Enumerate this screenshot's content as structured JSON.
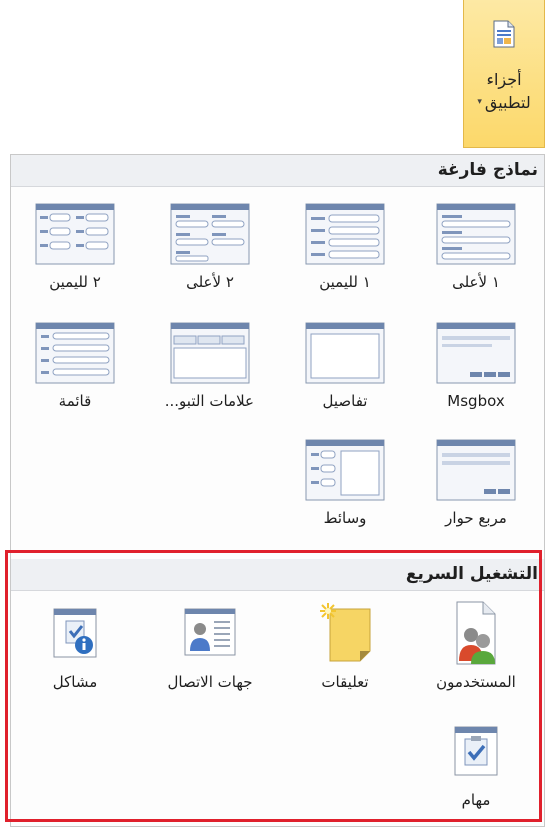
{
  "ribbon": {
    "button_line1": "أجزاء",
    "button_line2": "لتطبيق",
    "dropdown_caret": "▾"
  },
  "blank_forms": {
    "title": "نماذج فارغة",
    "items": [
      {
        "label": "١ لأعلى",
        "icon": "layout-top-1-icon"
      },
      {
        "label": "١ لليمين",
        "icon": "layout-right-1-icon"
      },
      {
        "label": "٢ لأعلى",
        "icon": "layout-top-2-icon"
      },
      {
        "label": "٢ لليمين",
        "icon": "layout-right-2-icon"
      },
      {
        "label": "Msgbox",
        "icon": "msgbox-icon"
      },
      {
        "label": "تفاصيل",
        "icon": "details-icon"
      },
      {
        "label": "علامات التبو...",
        "icon": "tabs-icon"
      },
      {
        "label": "قائمة",
        "icon": "list-icon"
      },
      {
        "label": "مربع حوار",
        "icon": "dialog-icon"
      },
      {
        "label": "وسائط",
        "icon": "media-icon"
      }
    ]
  },
  "quick_start": {
    "title": "التشغيل السريع",
    "items": [
      {
        "label": "المستخدمون",
        "icon": "users-icon"
      },
      {
        "label": "تعليقات",
        "icon": "comments-icon"
      },
      {
        "label": "جهات الاتصال",
        "icon": "contacts-icon"
      },
      {
        "label": "مشاكل",
        "icon": "issues-icon"
      },
      {
        "label": "مهام",
        "icon": "tasks-icon"
      }
    ]
  },
  "colors": {
    "ribbon_highlight": "#fcd86a",
    "section_header": "#eef0f3",
    "highlight_border": "#e0202c"
  }
}
